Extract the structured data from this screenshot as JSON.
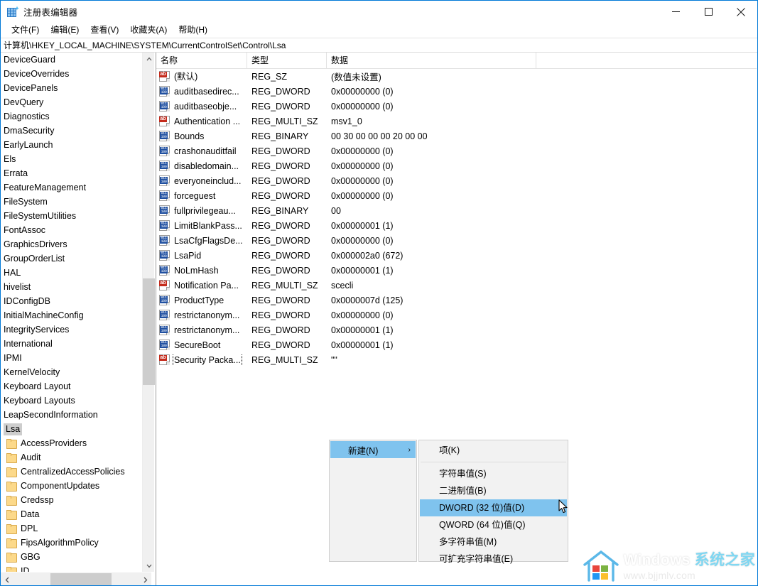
{
  "window": {
    "title": "注册表编辑器",
    "app_icon": "registry-editor-icon",
    "minimize_label": "最小化",
    "maximize_label": "最大化",
    "close_label": "关闭"
  },
  "menubar": {
    "items": [
      {
        "label": "文件(F)"
      },
      {
        "label": "编辑(E)"
      },
      {
        "label": "查看(V)"
      },
      {
        "label": "收藏夹(A)"
      },
      {
        "label": "帮助(H)"
      }
    ]
  },
  "address": {
    "path": "计算机\\HKEY_LOCAL_MACHINE\\SYSTEM\\CurrentControlSet\\Control\\Lsa"
  },
  "tree": {
    "items": [
      {
        "label": "DeviceGuard",
        "child": false,
        "selected": false
      },
      {
        "label": "DeviceOverrides",
        "child": false,
        "selected": false
      },
      {
        "label": "DevicePanels",
        "child": false,
        "selected": false
      },
      {
        "label": "DevQuery",
        "child": false,
        "selected": false
      },
      {
        "label": "Diagnostics",
        "child": false,
        "selected": false
      },
      {
        "label": "DmaSecurity",
        "child": false,
        "selected": false
      },
      {
        "label": "EarlyLaunch",
        "child": false,
        "selected": false
      },
      {
        "label": "Els",
        "child": false,
        "selected": false
      },
      {
        "label": "Errata",
        "child": false,
        "selected": false
      },
      {
        "label": "FeatureManagement",
        "child": false,
        "selected": false
      },
      {
        "label": "FileSystem",
        "child": false,
        "selected": false
      },
      {
        "label": "FileSystemUtilities",
        "child": false,
        "selected": false
      },
      {
        "label": "FontAssoc",
        "child": false,
        "selected": false
      },
      {
        "label": "GraphicsDrivers",
        "child": false,
        "selected": false
      },
      {
        "label": "GroupOrderList",
        "child": false,
        "selected": false
      },
      {
        "label": "HAL",
        "child": false,
        "selected": false
      },
      {
        "label": "hivelist",
        "child": false,
        "selected": false
      },
      {
        "label": "IDConfigDB",
        "child": false,
        "selected": false
      },
      {
        "label": "InitialMachineConfig",
        "child": false,
        "selected": false
      },
      {
        "label": "IntegrityServices",
        "child": false,
        "selected": false
      },
      {
        "label": "International",
        "child": false,
        "selected": false
      },
      {
        "label": "IPMI",
        "child": false,
        "selected": false
      },
      {
        "label": "KernelVelocity",
        "child": false,
        "selected": false
      },
      {
        "label": "Keyboard Layout",
        "child": false,
        "selected": false
      },
      {
        "label": "Keyboard Layouts",
        "child": false,
        "selected": false
      },
      {
        "label": "LeapSecondInformation",
        "child": false,
        "selected": false
      },
      {
        "label": "Lsa",
        "child": false,
        "selected": true
      },
      {
        "label": "AccessProviders",
        "child": true,
        "selected": false
      },
      {
        "label": "Audit",
        "child": true,
        "selected": false
      },
      {
        "label": "CentralizedAccessPolicies",
        "child": true,
        "selected": false
      },
      {
        "label": "ComponentUpdates",
        "child": true,
        "selected": false
      },
      {
        "label": "Credssp",
        "child": true,
        "selected": false
      },
      {
        "label": "Data",
        "child": true,
        "selected": false
      },
      {
        "label": "DPL",
        "child": true,
        "selected": false
      },
      {
        "label": "FipsAlgorithmPolicy",
        "child": true,
        "selected": false
      },
      {
        "label": "GBG",
        "child": true,
        "selected": false
      },
      {
        "label": "ID",
        "child": true,
        "selected": false
      }
    ]
  },
  "list": {
    "columns": [
      "名称",
      "类型",
      "数据"
    ],
    "rows": [
      {
        "icon": "string-value-icon",
        "name": "(默认)",
        "type": "REG_SZ",
        "data": "(数值未设置)",
        "focused": false
      },
      {
        "icon": "dword-value-icon",
        "name": "auditbasedirec...",
        "type": "REG_DWORD",
        "data": "0x00000000 (0)",
        "focused": false
      },
      {
        "icon": "dword-value-icon",
        "name": "auditbaseobje...",
        "type": "REG_DWORD",
        "data": "0x00000000 (0)",
        "focused": false
      },
      {
        "icon": "string-value-icon",
        "name": "Authentication ...",
        "type": "REG_MULTI_SZ",
        "data": "msv1_0",
        "focused": false
      },
      {
        "icon": "dword-value-icon",
        "name": "Bounds",
        "type": "REG_BINARY",
        "data": "00 30 00 00 00 20 00 00",
        "focused": false
      },
      {
        "icon": "dword-value-icon",
        "name": "crashonauditfail",
        "type": "REG_DWORD",
        "data": "0x00000000 (0)",
        "focused": false
      },
      {
        "icon": "dword-value-icon",
        "name": "disabledomain...",
        "type": "REG_DWORD",
        "data": "0x00000000 (0)",
        "focused": false
      },
      {
        "icon": "dword-value-icon",
        "name": "everyoneinclud...",
        "type": "REG_DWORD",
        "data": "0x00000000 (0)",
        "focused": false
      },
      {
        "icon": "dword-value-icon",
        "name": "forceguest",
        "type": "REG_DWORD",
        "data": "0x00000000 (0)",
        "focused": false
      },
      {
        "icon": "dword-value-icon",
        "name": "fullprivilegeau...",
        "type": "REG_BINARY",
        "data": "00",
        "focused": false
      },
      {
        "icon": "dword-value-icon",
        "name": "LimitBlankPass...",
        "type": "REG_DWORD",
        "data": "0x00000001 (1)",
        "focused": false
      },
      {
        "icon": "dword-value-icon",
        "name": "LsaCfgFlagsDe...",
        "type": "REG_DWORD",
        "data": "0x00000000 (0)",
        "focused": false
      },
      {
        "icon": "dword-value-icon",
        "name": "LsaPid",
        "type": "REG_DWORD",
        "data": "0x000002a0 (672)",
        "focused": false
      },
      {
        "icon": "dword-value-icon",
        "name": "NoLmHash",
        "type": "REG_DWORD",
        "data": "0x00000001 (1)",
        "focused": false
      },
      {
        "icon": "string-value-icon",
        "name": "Notification Pa...",
        "type": "REG_MULTI_SZ",
        "data": "scecli",
        "focused": false
      },
      {
        "icon": "dword-value-icon",
        "name": "ProductType",
        "type": "REG_DWORD",
        "data": "0x0000007d (125)",
        "focused": false
      },
      {
        "icon": "dword-value-icon",
        "name": "restrictanonym...",
        "type": "REG_DWORD",
        "data": "0x00000000 (0)",
        "focused": false
      },
      {
        "icon": "dword-value-icon",
        "name": "restrictanonym...",
        "type": "REG_DWORD",
        "data": "0x00000001 (1)",
        "focused": false
      },
      {
        "icon": "dword-value-icon",
        "name": "SecureBoot",
        "type": "REG_DWORD",
        "data": "0x00000001 (1)",
        "focused": false
      },
      {
        "icon": "string-value-icon",
        "name": "Security Packa...",
        "type": "REG_MULTI_SZ",
        "data": "\"\"",
        "focused": true
      }
    ]
  },
  "context_menu": {
    "parent": {
      "label": "新建(N)",
      "submenu_arrow": "›",
      "highlighted": true
    },
    "submenu": [
      {
        "label": "项(K)",
        "highlighted": false,
        "separator_after": true
      },
      {
        "label": "字符串值(S)",
        "highlighted": false,
        "separator_after": false
      },
      {
        "label": "二进制值(B)",
        "highlighted": false,
        "separator_after": false
      },
      {
        "label": "DWORD (32 位)值(D)",
        "highlighted": true,
        "separator_after": false
      },
      {
        "label": "QWORD (64 位)值(Q)",
        "highlighted": false,
        "separator_after": false
      },
      {
        "label": "多字符串值(M)",
        "highlighted": false,
        "separator_after": false
      },
      {
        "label": "可扩充字符串值(E)",
        "highlighted": false,
        "separator_after": false
      }
    ]
  },
  "watermark": {
    "brand_en": "Windows ",
    "brand_cn": "系统之家",
    "url": "www.bjjmlv.com",
    "logo": "windows-home-logo"
  },
  "colors": {
    "accent": "#0078d7",
    "menu_highlight": "#7fc3ee",
    "tree_selection": "#cdcdcd",
    "string_icon": "#c42b1c",
    "dword_icon": "#1f4fa0",
    "folder": "#fcd98a",
    "scrollbar_thumb": "#cdcdcd",
    "watermark_cn": "#7fd7f2"
  }
}
